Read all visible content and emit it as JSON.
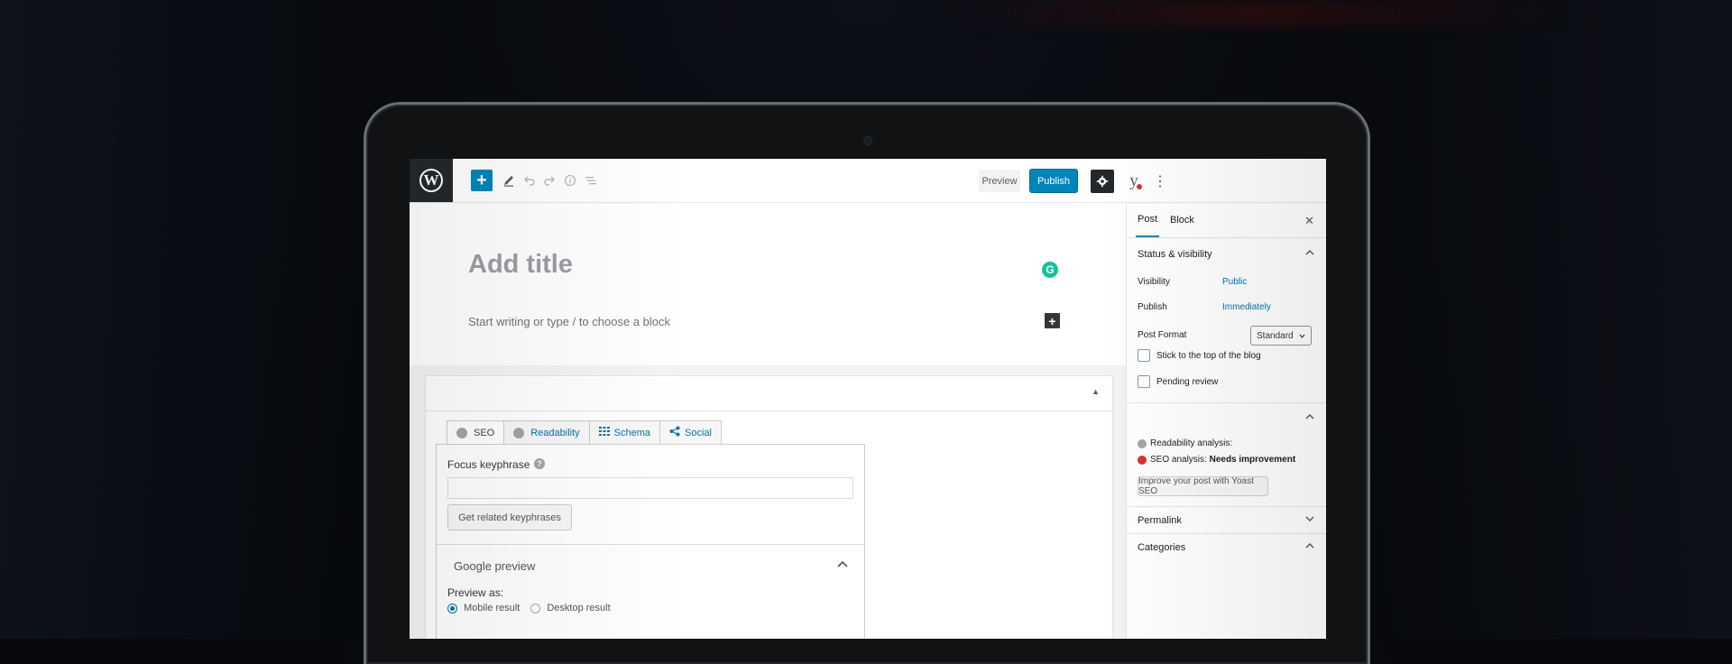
{
  "toolbar": {
    "add_icon": "plus-icon",
    "edit_icon": "pencil-icon",
    "undo_icon": "undo-icon",
    "redo_icon": "redo-icon",
    "info_icon": "info-icon",
    "outline_icon": "list-icon",
    "preview_label": "Preview",
    "publish_label": "Publish",
    "settings_icon": "gear-icon",
    "yoast_label": "y",
    "more_icon": "ellipsis-vertical-icon"
  },
  "editor": {
    "title_placeholder": "Add title",
    "body_placeholder": "Start writing or type / to choose a block",
    "grammarly_label": "G"
  },
  "yoast_box": {
    "tabs": [
      {
        "label": "SEO",
        "icon": "status-dot"
      },
      {
        "label": "Readability",
        "icon": "status-dot"
      },
      {
        "label": "Schema",
        "icon": "grid-icon"
      },
      {
        "label": "Social",
        "icon": "share-icon"
      }
    ],
    "focus_label": "Focus keyphrase",
    "help_label": "?",
    "focus_value": "",
    "related_button": "Get related keyphrases",
    "google_preview_title": "Google preview",
    "preview_as_label": "Preview as:",
    "radio_mobile": "Mobile result",
    "radio_desktop": "Desktop result"
  },
  "sidebar": {
    "tab_post": "Post",
    "tab_block": "Block",
    "close_icon": "close-icon",
    "status_title": "Status & visibility",
    "visibility_label": "Visibility",
    "visibility_value": "Public",
    "publish_label": "Publish",
    "publish_value": "Immediately",
    "format_label": "Post Format",
    "format_value": "Standard",
    "stick_label": "Stick to the top of the blog",
    "pending_label": "Pending review",
    "readability_label": "Readability analysis:",
    "seo_label": "SEO analysis:",
    "seo_value": "Needs improvement",
    "improve_button": "Improve your post with Yoast SEO",
    "permalink_title": "Permalink",
    "categories_title": "Categories"
  },
  "colors": {
    "accent": "#0085ba",
    "link": "#0073aa",
    "seo_bad": "#dc3232",
    "neutral_dot": "#a0a5aa",
    "grammarly": "#15c39a"
  }
}
